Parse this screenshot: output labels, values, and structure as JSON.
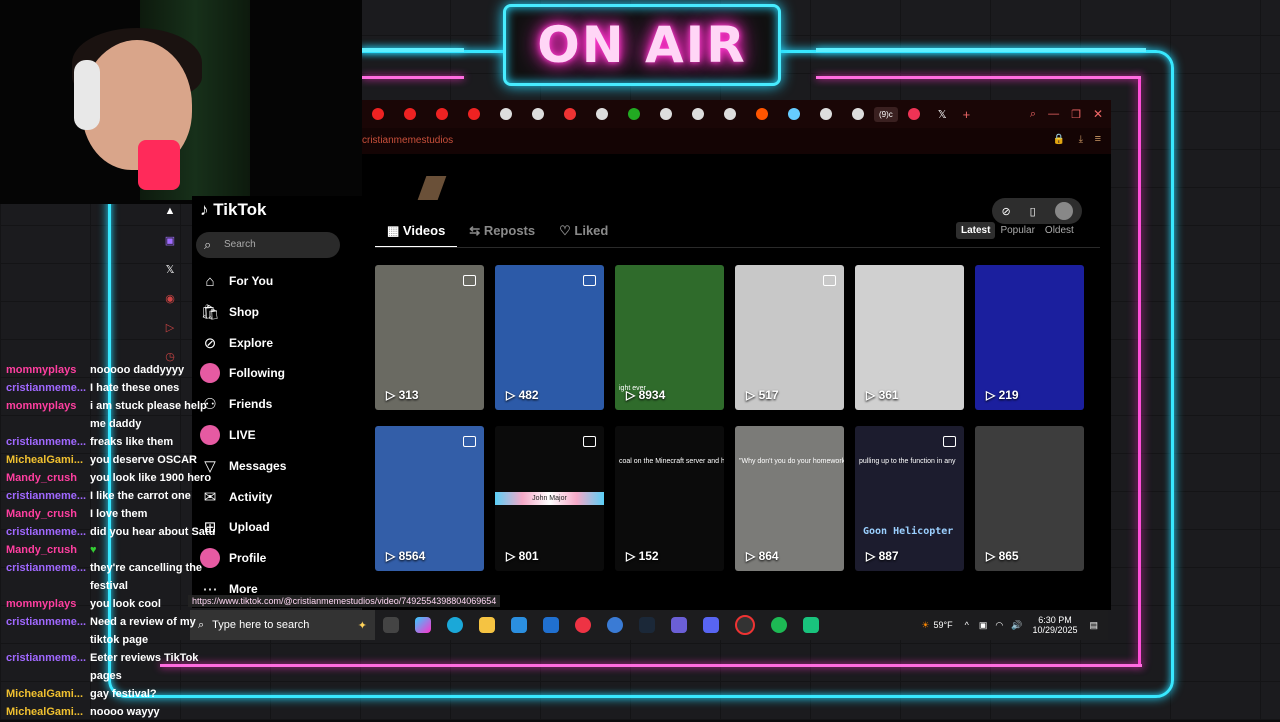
{
  "overlay": {
    "on_air": "ON AIR"
  },
  "browser": {
    "url_fragment": "cristianmemestudios",
    "tab_badge": "(9)c"
  },
  "tiktok": {
    "logo": "TikTok",
    "search_placeholder": "Search",
    "nav": [
      {
        "label": "For You",
        "icon": "home-icon",
        "glyph": "⌂"
      },
      {
        "label": "Shop",
        "icon": "shop-icon",
        "glyph": "🛍"
      },
      {
        "label": "Explore",
        "icon": "explore-icon",
        "glyph": "⊘"
      },
      {
        "label": "Following",
        "icon": "following-avatar",
        "glyph": ""
      },
      {
        "label": "Friends",
        "icon": "friends-icon",
        "glyph": "⚇"
      },
      {
        "label": "LIVE",
        "icon": "live-avatar",
        "glyph": ""
      },
      {
        "label": "Messages",
        "icon": "messages-icon",
        "glyph": "▽"
      },
      {
        "label": "Activity",
        "icon": "activity-icon",
        "glyph": "✉"
      },
      {
        "label": "Upload",
        "icon": "upload-icon",
        "glyph": "⊞"
      },
      {
        "label": "Profile",
        "icon": "profile-avatar",
        "glyph": ""
      },
      {
        "label": "More",
        "icon": "more-icon",
        "glyph": "⋯"
      }
    ],
    "tabs": [
      "Videos",
      "Reposts",
      "Liked"
    ],
    "sort": [
      "Latest",
      "Popular",
      "Oldest"
    ],
    "videos": [
      {
        "views": "313",
        "caption": "",
        "pinned": true,
        "color": "#6a6a62"
      },
      {
        "views": "482",
        "caption": "",
        "pinned": true,
        "color": "#2c5aa8"
      },
      {
        "views": "8934",
        "caption": "ight ever",
        "pinned": false,
        "color": "#2f6b2b"
      },
      {
        "views": "517",
        "caption": "",
        "pinned": true,
        "color": "#c8c8c8"
      },
      {
        "views": "361",
        "caption": "",
        "pinned": false,
        "color": "#d0d0d0"
      },
      {
        "views": "219",
        "caption": "",
        "pinned": false,
        "color": "#1b1f9e"
      },
      {
        "views": "8564",
        "caption": "",
        "pinned": true,
        "color": "#335ea8"
      },
      {
        "views": "801",
        "caption": "John Major",
        "pinned": true,
        "color": "#0b0b0b"
      },
      {
        "views": "152",
        "caption": "coal on the Minecraft server and hi",
        "pinned": false,
        "color": "#0b0b0b"
      },
      {
        "views": "864",
        "caption": "\"Why don't you do your homework during your frees\"",
        "pinned": false,
        "color": "#7b7b78"
      },
      {
        "views": "887",
        "caption": "pulling up to the function in any",
        "pinned": true,
        "color": "#1c1c2e"
      },
      {
        "views": "865",
        "caption": "",
        "pinned": false,
        "color": "#3d3d3d"
      }
    ],
    "overlay_text_video_11": "Goon Helicopter"
  },
  "status_url": "https://www.tiktok.com/@cristianmemestudios/video/7492554398804069654",
  "taskbar": {
    "search_placeholder": "Type here to search",
    "weather": "59°F",
    "time": "6:30 PM",
    "date": "10/29/2025"
  },
  "chat": [
    {
      "user": "mommyplays",
      "text": "nooooo daddyyyy",
      "color": "#ff3fa0"
    },
    {
      "user": "cristianmeme...",
      "text": "I hate these ones",
      "color": "#a068ff"
    },
    {
      "user": "mommyplays",
      "text": "i am stuck please help",
      "color": "#ff3fa0"
    },
    {
      "user": "",
      "text": "me daddy",
      "color": "#ff3fa0"
    },
    {
      "user": "cristianmeme...",
      "text": "freaks like them",
      "color": "#a068ff"
    },
    {
      "user": "MichealGami...",
      "text": "you deserve OSCAR",
      "color": "#f0c030"
    },
    {
      "user": "Mandy_crush",
      "text": "you look like 1900 hero",
      "color": "#ff3fa0"
    },
    {
      "user": "cristianmeme...",
      "text": "I like the carrot one",
      "color": "#a068ff"
    },
    {
      "user": "Mandy_crush",
      "text": "I love them",
      "color": "#ff3fa0"
    },
    {
      "user": "cristianmeme...",
      "text": "did you hear about Satu",
      "color": "#a068ff"
    },
    {
      "user": "Mandy_crush",
      "text": "♥",
      "color": "#ff3fa0"
    },
    {
      "user": "cristianmeme...",
      "text": "they're cancelling the",
      "color": "#a068ff"
    },
    {
      "user": "",
      "text": "festival",
      "color": "#a068ff"
    },
    {
      "user": "mommyplays",
      "text": "you look cool",
      "color": "#ff3fa0"
    },
    {
      "user": "cristianmeme...",
      "text": "Need a review of my",
      "color": "#a068ff"
    },
    {
      "user": "",
      "text": "tiktok page",
      "color": "#a068ff"
    },
    {
      "user": "cristianmeme...",
      "text": "Eeter reviews TikTok",
      "color": "#a068ff"
    },
    {
      "user": "",
      "text": "pages",
      "color": "#a068ff"
    },
    {
      "user": "MichealGami...",
      "text": "gay festival?",
      "color": "#f0c030"
    },
    {
      "user": "MichealGami...",
      "text": "noooo wayyy",
      "color": "#f0c030"
    }
  ]
}
